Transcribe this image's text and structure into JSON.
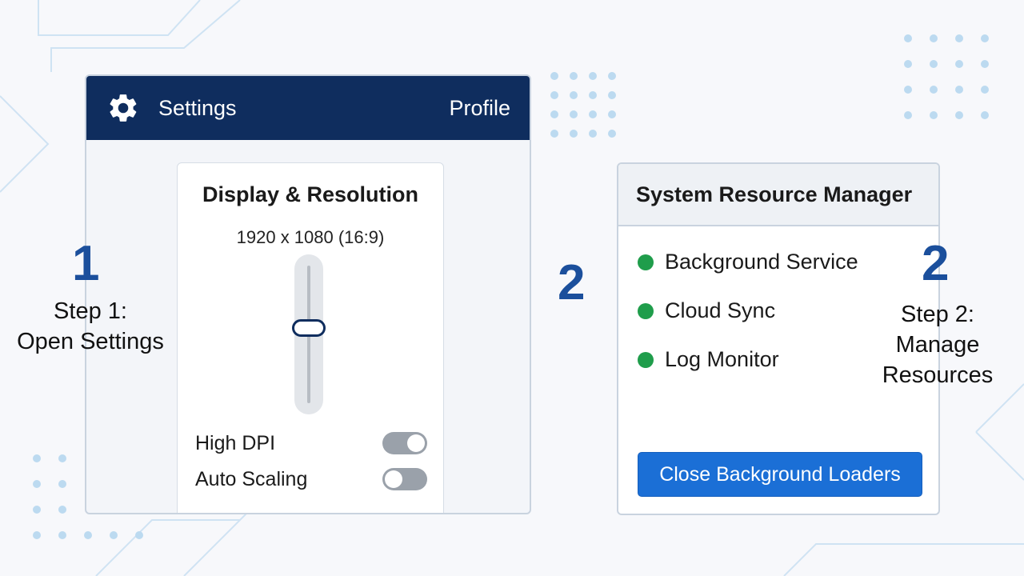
{
  "settings": {
    "title": "Settings",
    "profile": "Profile",
    "display": {
      "title": "Display & Resolution",
      "resolution": "1920 x 1080 (16:9)",
      "slider_level": 0.45,
      "toggles": [
        {
          "label": "High DPI",
          "state": "on"
        },
        {
          "label": "Auto Scaling",
          "state": "off"
        }
      ]
    }
  },
  "steps": {
    "left_number": "1",
    "left_text": [
      "Step 1:",
      "Open Settings"
    ],
    "middle_number": "2",
    "right_number": "2",
    "right_text": [
      "Step 2:",
      "Manage",
      "Resources"
    ]
  },
  "resource_manager": {
    "title": "System Resource Manager",
    "services": [
      {
        "label": "Background Service",
        "status": "running"
      },
      {
        "label": "Cloud Sync",
        "status": "running"
      },
      {
        "label": "Log Monitor",
        "status": "running"
      }
    ],
    "close_button": "Close Background Loaders"
  },
  "colors": {
    "header_navy": "#0f2d5e",
    "accent_blue": "#1b6fd6",
    "status_green": "#1f9d4b",
    "step_blue": "#1b4f9c"
  },
  "icons": {
    "settings": "gear-icon"
  }
}
